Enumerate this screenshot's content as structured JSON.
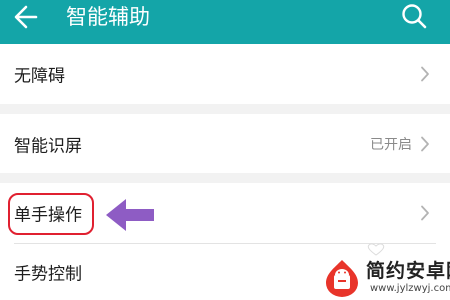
{
  "header": {
    "title": "智能辅助",
    "back_icon": "arrow-left-icon",
    "search_icon": "search-icon"
  },
  "rows": [
    {
      "label": "无障碍",
      "value": ""
    },
    {
      "label": "智能识屏",
      "value": "已开启"
    },
    {
      "label": "单手操作",
      "value": ""
    },
    {
      "label": "手势控制",
      "value": ""
    }
  ],
  "annotation": {
    "arrow_icon": "arrow-left-icon",
    "arrow_color": "#8e5cc4",
    "box_color": "#e02030"
  },
  "watermark": {
    "title": "简约安卓网",
    "url": "www.jylzwyj.com",
    "logo_icon": "android-logo-icon"
  },
  "colors": {
    "header_bg": "#14a5a8",
    "page_bg": "#f2f2f2",
    "row_bg": "#ffffff",
    "text": "#1e1e1e",
    "secondary_text": "#8a8a8a",
    "chevron": "#b3b3b3"
  }
}
